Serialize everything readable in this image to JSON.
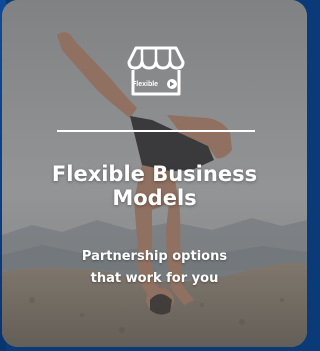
{
  "card": {
    "logo_text": "Flexible",
    "title_line1": "Flexible Business",
    "title_line2": "Models",
    "subtitle_line1": "Partnership options",
    "subtitle_line2": "that work for you"
  },
  "icons": {
    "storefront": "storefront-icon",
    "photo": "handstand-person-photo"
  },
  "colors": {
    "text": "#ffffff",
    "background_edge": "#0a3a78",
    "overlay": "#6e6e6e"
  }
}
